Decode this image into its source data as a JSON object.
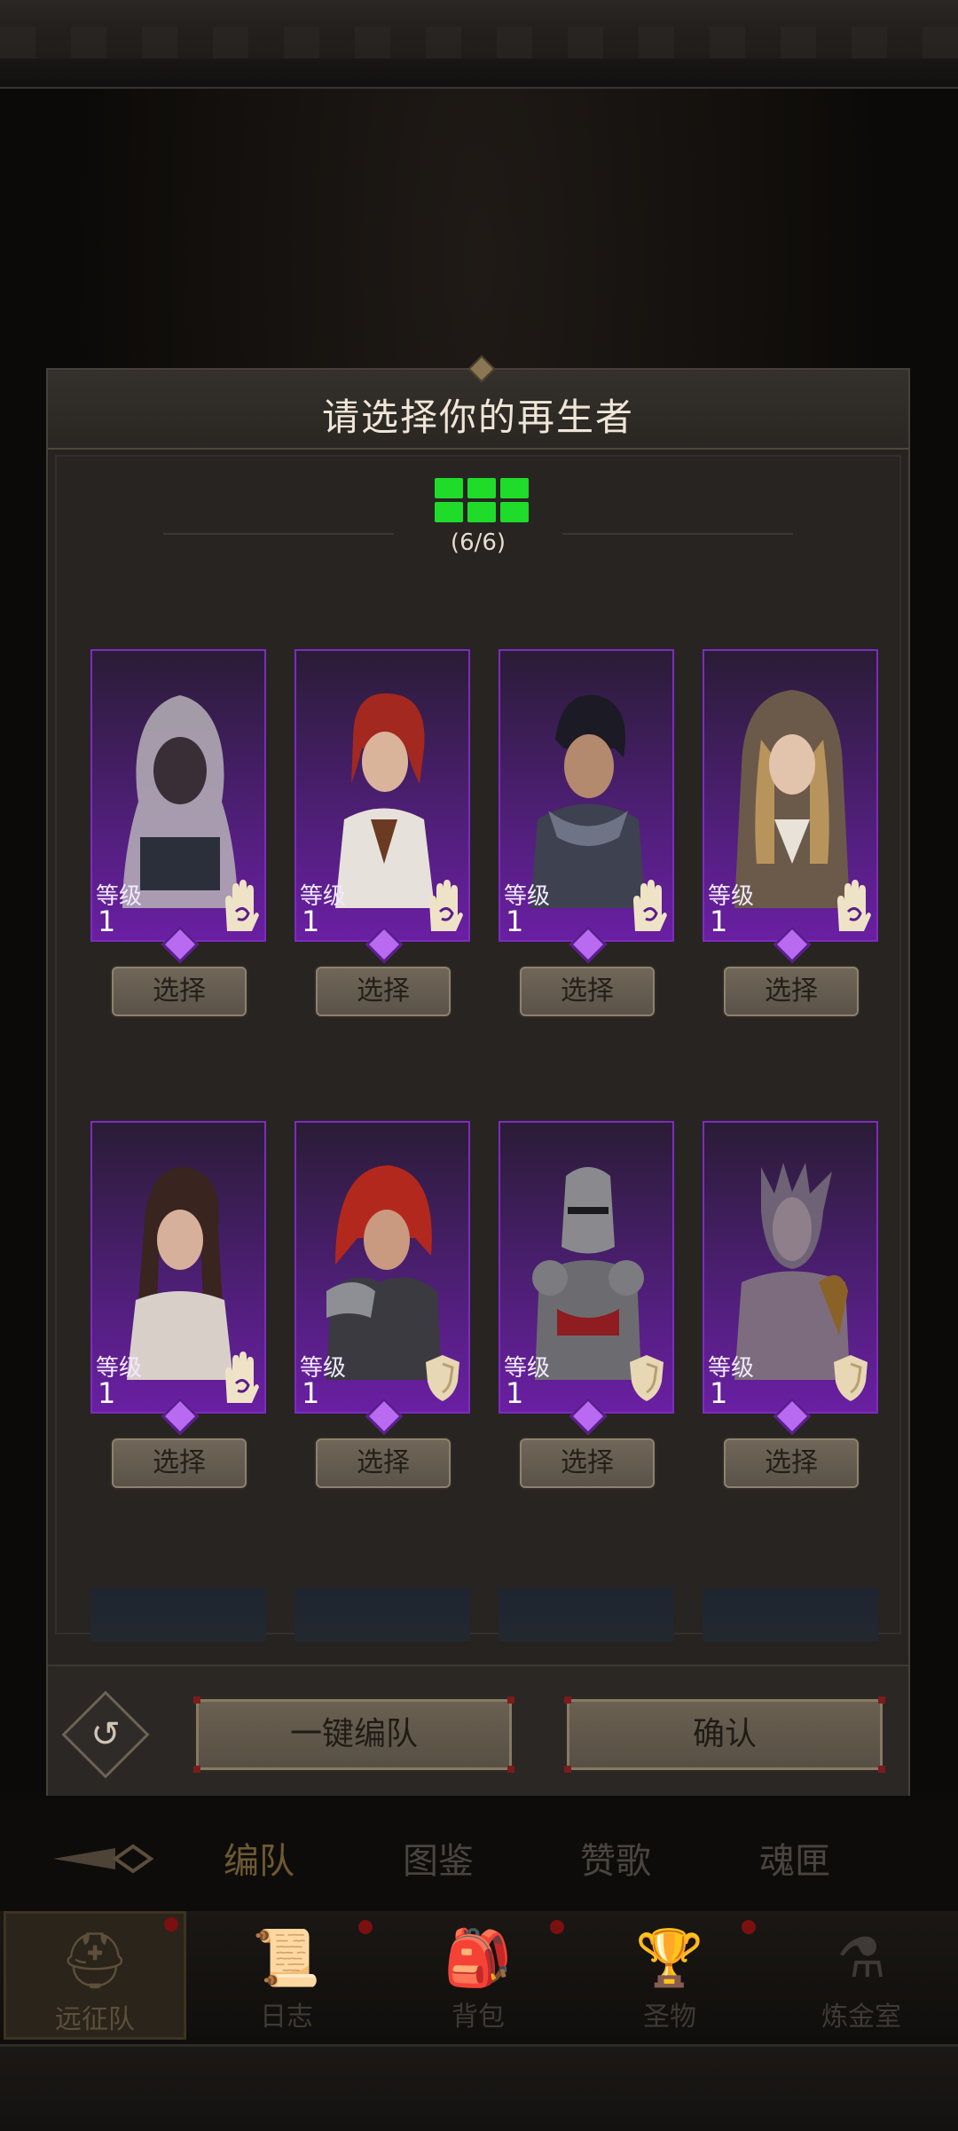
{
  "modal": {
    "title": "请选择你的再生者",
    "slots_label": "(6/6)",
    "slots_filled": 6,
    "slots_total": 6
  },
  "heroes": [
    {
      "level_label": "等级",
      "level": "1",
      "class": "hand-icon",
      "select_label": "选择"
    },
    {
      "level_label": "等级",
      "level": "1",
      "class": "hand-icon",
      "select_label": "选择"
    },
    {
      "level_label": "等级",
      "level": "1",
      "class": "hand-icon",
      "select_label": "选择"
    },
    {
      "level_label": "等级",
      "level": "1",
      "class": "hand-icon",
      "select_label": "选择"
    },
    {
      "level_label": "等级",
      "level": "1",
      "class": "hand-icon",
      "select_label": "选择"
    },
    {
      "level_label": "等级",
      "level": "1",
      "class": "shield-icon",
      "select_label": "选择"
    },
    {
      "level_label": "等级",
      "level": "1",
      "class": "shield-icon",
      "select_label": "选择"
    },
    {
      "level_label": "等级",
      "level": "1",
      "class": "shield-icon",
      "select_label": "选择"
    }
  ],
  "footer": {
    "auto_team_label": "一键编队",
    "confirm_label": "确认"
  },
  "bg_tabs": [
    "编队",
    "图鉴",
    "赞歌",
    "魂匣"
  ],
  "bottom_nav": [
    "远征队",
    "日志",
    "背包",
    "圣物",
    "炼金室"
  ],
  "colors": {
    "slot_green": "#1fdc2a",
    "portrait_purple": "#6a1fa3",
    "badge_red": "#7a1010"
  }
}
